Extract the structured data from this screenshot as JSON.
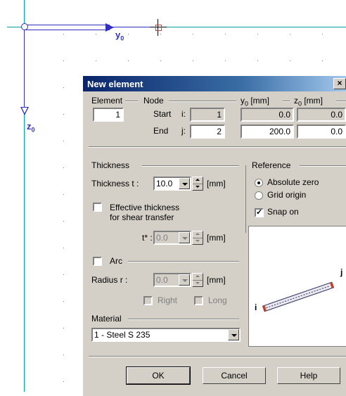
{
  "canvas": {
    "y_axis_label": "y",
    "y_axis_sub": "0",
    "z_axis_label": "z",
    "z_axis_sub": "0",
    "colors": {
      "axis_blue": "#3030c0",
      "gridline": "#00a0a0"
    }
  },
  "dialog": {
    "title": "New element",
    "close_label": "×",
    "element_group": "Element",
    "element_value": "1",
    "node_group": "Node",
    "y0_header": "y0 [mm]",
    "z0_header": "z0 [mm]",
    "start_label": "Start",
    "start_sub": "i:",
    "start_node": "1",
    "start_y0": "0.0",
    "start_z0": "0.0",
    "end_label": "End",
    "end_sub": "j:",
    "end_node": "2",
    "end_y0": "200.0",
    "end_z0": "0.0",
    "thickness_group": "Thickness",
    "thickness_label": "Thickness  t :",
    "thickness_value": "10.0",
    "thickness_unit": "[mm]",
    "effective_label_1": "Effective thickness",
    "effective_label_2": "for shear transfer",
    "tstar_label": "t* :",
    "tstar_value": "0.0",
    "tstar_unit": "[mm]",
    "arc_label": "Arc",
    "radius_label": "Radius r :",
    "radius_value": "0.0",
    "radius_unit": "[mm]",
    "right_label": "Right",
    "long_label": "Long",
    "material_group": "Material",
    "material_value": "1 - Steel S 235",
    "reference_group": "Reference",
    "absolute_zero": "Absolute zero",
    "grid_origin": "Grid origin",
    "snap_on": "Snap on",
    "preview_i": "i",
    "preview_j": "j",
    "ok": "OK",
    "cancel": "Cancel",
    "help": "Help"
  }
}
